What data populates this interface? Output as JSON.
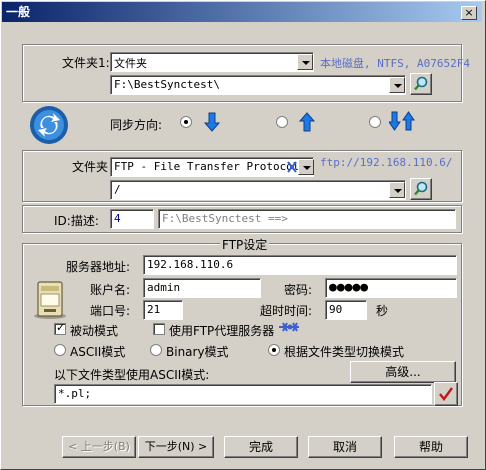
{
  "window": {
    "title": "一般",
    "close_label": "×"
  },
  "folder1": {
    "label": "文件夹1:",
    "type_value": "文件夹",
    "disk_info": "本地磁盘, NTFS, A07652F4",
    "path_value": "F:\\BestSynctest\\"
  },
  "sync": {
    "label": "同步方向:",
    "options": [
      {
        "direction": "right",
        "selected": true
      },
      {
        "direction": "up",
        "selected": false
      },
      {
        "direction": "both",
        "selected": false
      }
    ]
  },
  "folder2": {
    "label": "文件夹",
    "protocol_value": "FTP - File Transfer Protocol",
    "ftp_url": "ftp://192.168.110.6/",
    "path_value": "/"
  },
  "id_row": {
    "label": "ID:描述:",
    "id_value": "4",
    "description_value": "F:\\BestSynctest ==>"
  },
  "ftp": {
    "section_title": "FTP设定",
    "server_label": "服务器地址:",
    "server_value": "192.168.110.6",
    "account_label": "账户名:",
    "account_value": "admin",
    "password_label": "密码:",
    "password_value": "●●●●●",
    "port_label": "端口号:",
    "port_value": "21",
    "timeout_label": "超时时间:",
    "timeout_value": "90",
    "timeout_unit": "秒",
    "passive_label": "被动模式",
    "passive_checked": true,
    "proxy_label": "使用FTP代理服务器",
    "proxy_checked": false,
    "mode_ascii": "ASCII模式",
    "mode_binary": "Binary模式",
    "mode_auto": "根据文件类型切换模式",
    "ascii_types_label": "以下文件类型使用ASCII模式:",
    "advanced_label": "高级...",
    "ascii_types_value": "*.pl;"
  },
  "buttons": {
    "back": "< 上一步(B)",
    "next": "下一步(N) >",
    "finish": "完成",
    "cancel": "取消",
    "help": "帮助"
  },
  "colors": {
    "title_start": "#0a246a",
    "title_end": "#a6caf0",
    "face": "#d4d0c8",
    "arrow_blue": "#1e78e6"
  }
}
